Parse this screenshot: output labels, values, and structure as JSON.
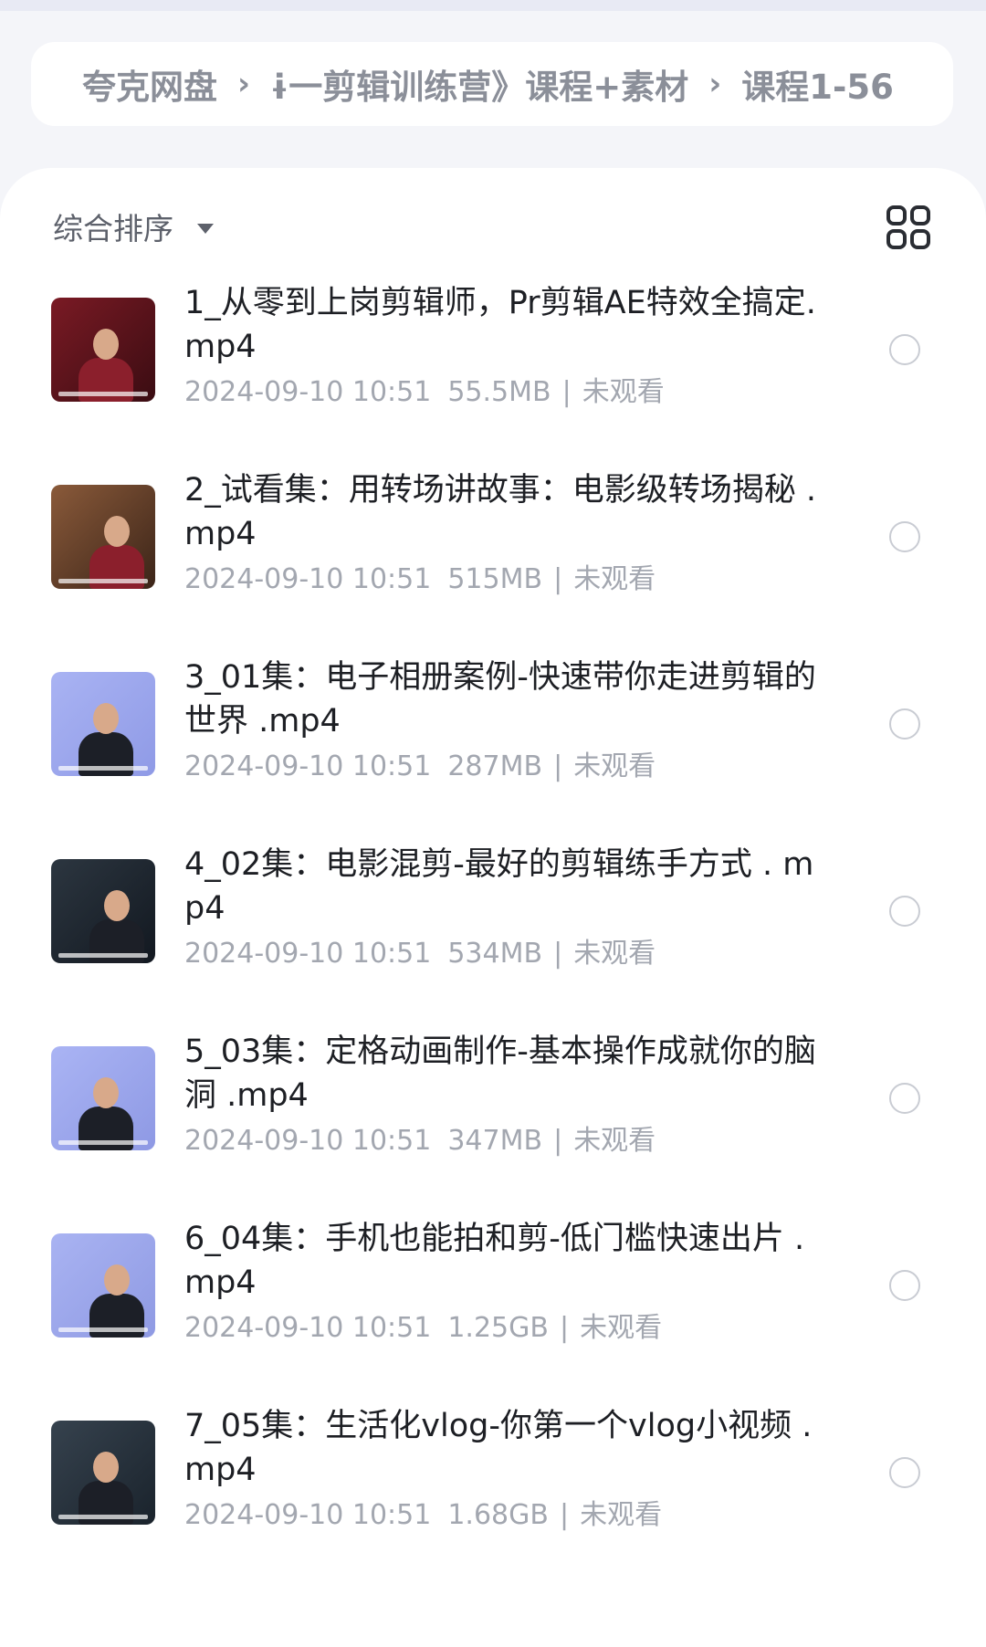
{
  "breadcrumb": {
    "root": "夸克网盘",
    "middle": "ɨ一剪辑训练营》课程+素材",
    "current": "课程1-56",
    "separator": "›"
  },
  "toolbar": {
    "sort_label": "综合排序",
    "view_toggle_icon": "grid-view-icon"
  },
  "files": [
    {
      "title": "1_从零到上岗剪辑师，Pr剪辑AE特效全搞定.mp4",
      "date": "2024-09-10 10:51",
      "size": "55.5MB",
      "status": "未观看",
      "thumb_colors": [
        "#7a1a24",
        "#3a0c12"
      ]
    },
    {
      "title": "2_试看集：用转场讲故事：电影级转场揭秘 .mp4",
      "date": "2024-09-10 10:51",
      "size": "515MB",
      "status": "未观看",
      "thumb_colors": [
        "#8a5a3a",
        "#3b2418"
      ]
    },
    {
      "title": "3_01集：电子相册案例-快速带你走进剪辑的世界 .mp4",
      "date": "2024-09-10 10:51",
      "size": "287MB",
      "status": "未观看",
      "thumb_colors": [
        "#a9b3f3",
        "#8f9ae6"
      ]
    },
    {
      "title": "4_02集：电影混剪-最好的剪辑练手方式 . mp4",
      "date": "2024-09-10 10:51",
      "size": "534MB",
      "status": "未观看",
      "thumb_colors": [
        "#2c3640",
        "#121820"
      ]
    },
    {
      "title": "5_03集：定格动画制作-基本操作成就你的脑洞 .mp4",
      "date": "2024-09-10 10:51",
      "size": "347MB",
      "status": "未观看",
      "thumb_colors": [
        "#aab4f4",
        "#8e99e4"
      ]
    },
    {
      "title": "6_04集：手机也能拍和剪-低门槛快速出片 .mp4",
      "date": "2024-09-10 10:51",
      "size": "1.25GB",
      "status": "未观看",
      "thumb_colors": [
        "#a9b3f2",
        "#8f9ae3"
      ]
    },
    {
      "title": "7_05集：生活化vlog-你第一个vlog小视频 .mp4",
      "date": "2024-09-10 10:51",
      "size": "1.68GB",
      "status": "未观看",
      "thumb_colors": [
        "#36424e",
        "#1a232c"
      ]
    }
  ]
}
